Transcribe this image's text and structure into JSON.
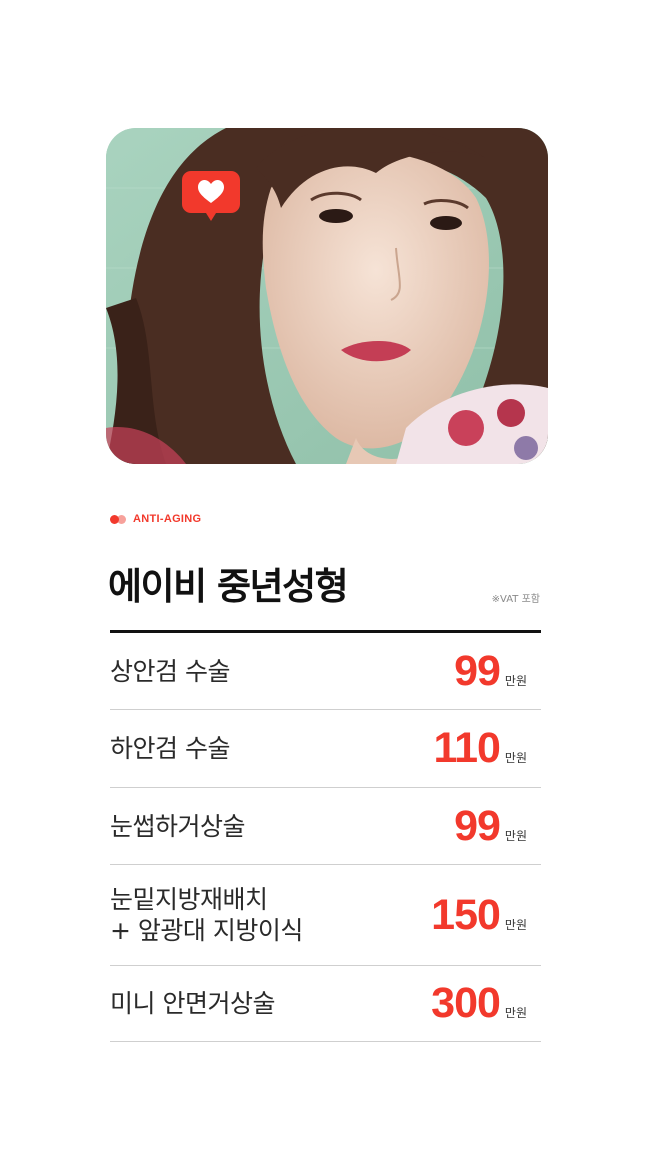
{
  "badge": {
    "icon": "heart-icon",
    "color": "#f2392c"
  },
  "tag": {
    "text": "ANTI-AGING",
    "color": "#f2392c"
  },
  "title": "에이비 중년성형",
  "vat_note": "※VAT 포함",
  "price_unit": "만원",
  "items": [
    {
      "label": "상안검 수술",
      "price": "99"
    },
    {
      "label": "하안검 수술",
      "price": "110"
    },
    {
      "label": "눈썹하거상술",
      "price": "99"
    },
    {
      "label": "눈밑지방재배치\n+ 앞광대 지방이식",
      "price": "150"
    },
    {
      "label": "미니 안면거상술",
      "price": "300"
    }
  ],
  "colors": {
    "accent": "#f2392c",
    "text": "#222222",
    "rule": "#111111"
  }
}
